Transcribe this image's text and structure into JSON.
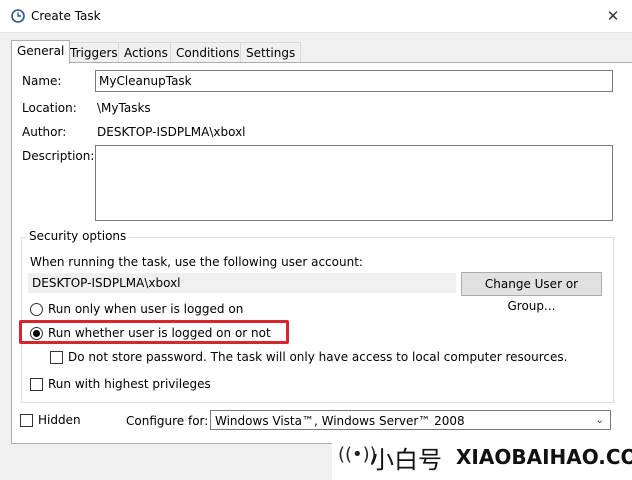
{
  "window": {
    "title": "Create Task",
    "close": "✕"
  },
  "tabs": [
    {
      "label": "General",
      "active": true
    },
    {
      "label": "Triggers",
      "active": false
    },
    {
      "label": "Actions",
      "active": false
    },
    {
      "label": "Conditions",
      "active": false
    },
    {
      "label": "Settings",
      "active": false
    }
  ],
  "general": {
    "name_label": "Name:",
    "name_value": "MyCleanupTask",
    "location_label": "Location:",
    "location_value": "\\MyTasks",
    "author_label": "Author:",
    "author_value": "DESKTOP-ISDPLMA\\xboxl",
    "description_label": "Description:",
    "description_value": ""
  },
  "security": {
    "legend": "Security options",
    "account_prompt": "When running the task, use the following user account:",
    "account_value": "DESKTOP-ISDPLMA\\xboxl",
    "change_button": "Change User or Group...",
    "radio_logged_on": "Run only when user is logged on",
    "radio_whether": "Run whether user is logged on or not",
    "radio_selected": "whether",
    "no_store_password": "Do not store password.  The task will only have access to local computer resources.",
    "no_store_checked": false,
    "highest_privileges": "Run with highest privileges",
    "highest_checked": false
  },
  "footer": {
    "hidden_label": "Hidden",
    "hidden_checked": false,
    "configure_label": "Configure for:",
    "configure_value": "Windows Vista™, Windows Server™ 2008"
  },
  "watermark": {
    "cn": "小白号",
    "en": "XIAOBAIHAO.COM",
    "icon": "signal-waves-icon"
  },
  "colors": {
    "highlight": "#d9252f",
    "panel": "#ffffff",
    "chrome": "#f0f0f0"
  }
}
